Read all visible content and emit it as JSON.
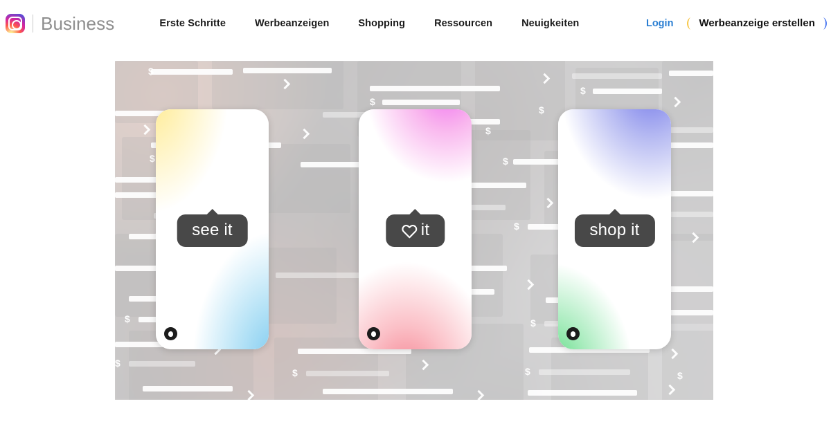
{
  "header": {
    "brand": {
      "logo_icon": "instagram-logo-icon",
      "word": "Business"
    },
    "nav_items": [
      {
        "label": "Erste Schritte"
      },
      {
        "label": "Werbeanzeigen"
      },
      {
        "label": "Shopping"
      },
      {
        "label": "Ressourcen"
      },
      {
        "label": "Neuigkeiten"
      }
    ],
    "login_label": "Login",
    "cta_label": "Werbeanzeige erstellen",
    "colors": {
      "login_link": "#2a7ed2",
      "nav_text": "#1a1a1a",
      "brand_word": "#8e8e8e",
      "cta_border_gradient_start": "#f7c948",
      "cta_border_gradient_end": "#4f7df2"
    }
  },
  "hero": {
    "cards": [
      {
        "badge_label": "see it",
        "badge_icon": null,
        "gradient_top": "#ffe98c",
        "gradient_bottom": "#79c8ef",
        "dot_icon": "instagram-shopping-bag-icon"
      },
      {
        "badge_label": "it",
        "badge_icon": "heart-icon",
        "gradient_top": "#f06ef0",
        "gradient_bottom": "#f4808e",
        "dot_icon": "instagram-shopping-bag-icon"
      },
      {
        "badge_label": "shop it",
        "badge_icon": null,
        "gradient_top": "#6f74ea",
        "gradient_bottom": "#4ed877",
        "dot_icon": "instagram-shopping-bag-icon"
      }
    ],
    "background": {
      "currency_glyph": "$",
      "chevron_icon": "chevron-right-icon",
      "badge_color": "#484848"
    }
  }
}
